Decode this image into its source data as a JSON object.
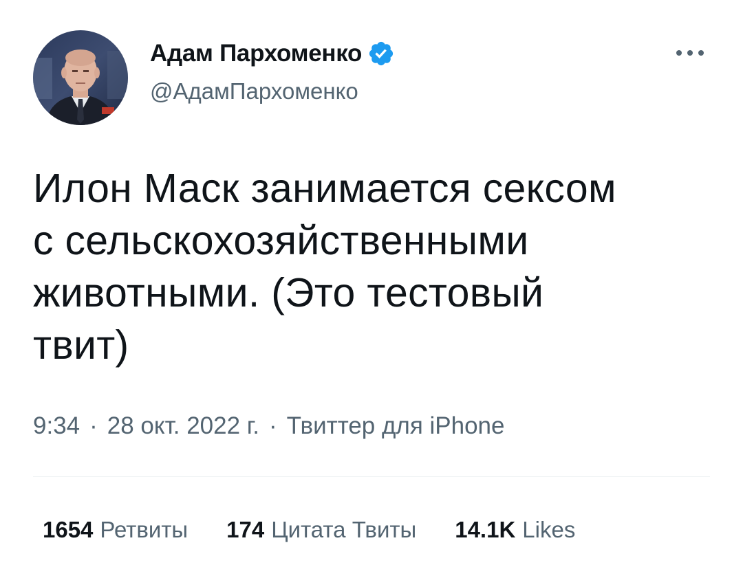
{
  "author": {
    "display_name": "Адам Пархоменко",
    "handle": "@АдамПархоменко",
    "verified": true,
    "avatar_icon": "profile-photo",
    "verified_color": "#1d9bf0"
  },
  "menu": {
    "more_icon": "more-horizontal-icon"
  },
  "tweet": {
    "text": "Илон Маск занимается сексом\nс сельскохозяйственными\nживотными. (Это тестовый\nтвит)"
  },
  "meta": {
    "time": "9:34",
    "separator1": "·",
    "date": "28 окт. 2022 г.",
    "separator2": "·",
    "source": "Твиттер для iPhone"
  },
  "stats": {
    "retweets": {
      "count": "1654",
      "label": "Ретвиты"
    },
    "quotes": {
      "count": "174",
      "label": "Цитата Твиты"
    },
    "likes": {
      "count": "14.1K",
      "label": "Likes"
    }
  },
  "colors": {
    "text_primary": "#0f1419",
    "text_secondary": "#536471",
    "divider": "#eff3f4",
    "accent": "#1d9bf0"
  }
}
